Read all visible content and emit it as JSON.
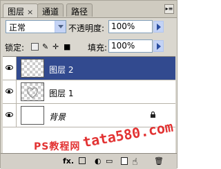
{
  "tabs": [
    {
      "label": "图层",
      "close": "×"
    },
    {
      "label": "通道"
    },
    {
      "label": "路径"
    }
  ],
  "blend_mode": {
    "value": "正常"
  },
  "opacity": {
    "label": "不透明度:",
    "value": "100%"
  },
  "lock": {
    "label": "锁定:"
  },
  "fill": {
    "label": "填充:",
    "value": "100%"
  },
  "layers": [
    {
      "name": "图层 2",
      "selected": true
    },
    {
      "name": "图层 1",
      "selected": false
    },
    {
      "name": "背景",
      "selected": false,
      "locked": true
    }
  ],
  "watermark": {
    "text": "PS教程网",
    "url": "tata580.com"
  },
  "colors": {
    "selection": "#324a8f",
    "panel": "#dad7cf",
    "watermark": "#e23232"
  }
}
